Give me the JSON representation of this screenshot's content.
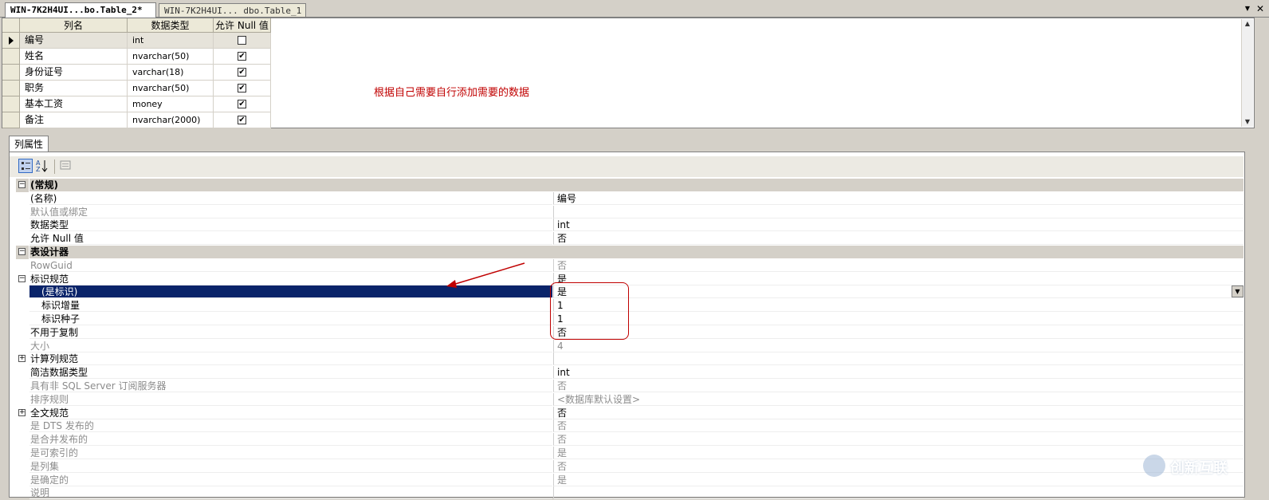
{
  "tabs": [
    {
      "label": "WIN-7K2H4UI...bo.Table_2*",
      "active": true
    },
    {
      "label": "WIN-7K2H4UI...  dbo.Table_1",
      "active": false
    }
  ],
  "tab_controls": {
    "dropdown": "▼",
    "close": "✕"
  },
  "grid": {
    "headers": [
      "列名",
      "数据类型",
      "允许 Null 值"
    ],
    "rows": [
      {
        "name": "编号",
        "type": "int",
        "allow_null": false
      },
      {
        "name": "姓名",
        "type": "nvarchar(50)",
        "allow_null": true
      },
      {
        "name": "身份证号",
        "type": "varchar(18)",
        "allow_null": true
      },
      {
        "name": "职务",
        "type": "nvarchar(50)",
        "allow_null": true
      },
      {
        "name": "基本工资",
        "type": "money",
        "allow_null": true
      },
      {
        "name": "备注",
        "type": "nvarchar(2000)",
        "allow_null": true
      }
    ],
    "check_mark": "✔"
  },
  "annotation": "根据自己需要自行添加需要的数据",
  "properties": {
    "tab_label": "列属性",
    "rows": [
      {
        "name": "(常规)",
        "value": "",
        "kind": "cat",
        "toggle": "⊟"
      },
      {
        "name": "(名称)",
        "value": "编号"
      },
      {
        "name": "默认值或绑定",
        "value": "",
        "disabled": true
      },
      {
        "name": "数据类型",
        "value": "int"
      },
      {
        "name": "允许 Null 值",
        "value": "否"
      },
      {
        "name": "表设计器",
        "value": "",
        "kind": "cat",
        "toggle": "⊟"
      },
      {
        "name": "RowGuid",
        "value": "否",
        "disabled": true
      },
      {
        "name": "标识规范",
        "value": "是",
        "toggle": "⊟"
      },
      {
        "name": "(是标识)",
        "value": "是",
        "indent": true,
        "selected": true
      },
      {
        "name": "标识增量",
        "value": "1",
        "indent": true
      },
      {
        "name": "标识种子",
        "value": "1",
        "indent": true
      },
      {
        "name": "不用于复制",
        "value": "否"
      },
      {
        "name": "大小",
        "value": "4",
        "disabled": true
      },
      {
        "name": "计算列规范",
        "value": "",
        "toggle": "⊞"
      },
      {
        "name": "简洁数据类型",
        "value": "int"
      },
      {
        "name": "具有非 SQL Server 订阅服务器",
        "value": "否",
        "disabled": true
      },
      {
        "name": "排序规则",
        "value": "<数据库默认设置>",
        "disabled": true
      },
      {
        "name": "全文规范",
        "value": "否",
        "toggle": "⊞"
      },
      {
        "name": "是 DTS 发布的",
        "value": "否",
        "disabled": true
      },
      {
        "name": "是合并发布的",
        "value": "否",
        "disabled": true
      },
      {
        "name": "是可索引的",
        "value": "是",
        "disabled": true
      },
      {
        "name": "是列集",
        "value": "否",
        "disabled": true
      },
      {
        "name": "是确定的",
        "value": "是",
        "disabled": true
      },
      {
        "name": "说明",
        "value": "",
        "disabled": true
      }
    ]
  },
  "watermark": "创新互联",
  "colors": {
    "selection": "#0a246a",
    "annotation": "#c00000",
    "chrome": "#d4d0c8"
  }
}
